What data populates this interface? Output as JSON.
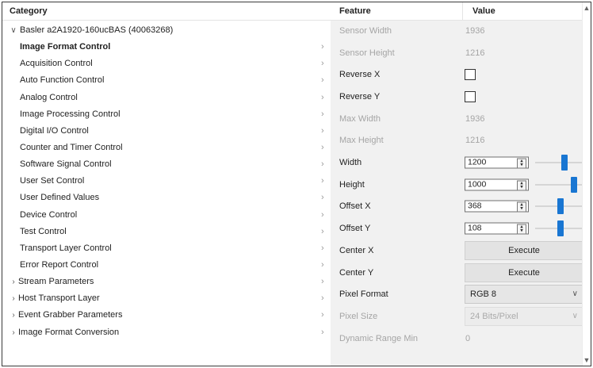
{
  "headers": {
    "category": "Category",
    "feature": "Feature",
    "value": "Value"
  },
  "tree": {
    "root_label": "Basler a2A1920-160ucBAS (40063268)",
    "children": [
      {
        "label": "Image Format Control",
        "selected": true
      },
      {
        "label": "Acquisition Control"
      },
      {
        "label": "Auto Function Control"
      },
      {
        "label": "Analog Control"
      },
      {
        "label": "Image Processing Control"
      },
      {
        "label": "Digital I/O Control"
      },
      {
        "label": "Counter and Timer Control"
      },
      {
        "label": "Software Signal Control"
      },
      {
        "label": "User Set Control"
      },
      {
        "label": "User Defined Values"
      },
      {
        "label": "Device Control"
      },
      {
        "label": "Test Control"
      },
      {
        "label": "Transport Layer Control"
      },
      {
        "label": "Error Report Control"
      }
    ],
    "siblings": [
      {
        "label": "Stream Parameters"
      },
      {
        "label": "Host Transport Layer"
      },
      {
        "label": "Event Grabber Parameters"
      },
      {
        "label": "Image Format Conversion"
      }
    ]
  },
  "features": [
    {
      "name": "Sensor Width",
      "value": "1936",
      "kind": "text",
      "disabled": true
    },
    {
      "name": "Sensor Height",
      "value": "1216",
      "kind": "text",
      "disabled": true
    },
    {
      "name": "Reverse X",
      "kind": "checkbox",
      "checked": false
    },
    {
      "name": "Reverse Y",
      "kind": "checkbox",
      "checked": false
    },
    {
      "name": "Max Width",
      "value": "1936",
      "kind": "text",
      "disabled": true
    },
    {
      "name": "Max Height",
      "value": "1216",
      "kind": "text",
      "disabled": true
    },
    {
      "name": "Width",
      "value": "1200",
      "kind": "spin",
      "slider_fraction": 0.6
    },
    {
      "name": "Height",
      "value": "1000",
      "kind": "spin",
      "slider_fraction": 0.8
    },
    {
      "name": "Offset X",
      "value": "368",
      "kind": "spin",
      "slider_fraction": 0.52
    },
    {
      "name": "Offset Y",
      "value": "108",
      "kind": "spin",
      "slider_fraction": 0.52
    },
    {
      "name": "Center X",
      "button_label": "Execute",
      "kind": "button"
    },
    {
      "name": "Center Y",
      "button_label": "Execute",
      "kind": "button"
    },
    {
      "name": "Pixel Format",
      "value": "RGB 8",
      "kind": "combo"
    },
    {
      "name": "Pixel Size",
      "value": "24 Bits/Pixel",
      "kind": "combo",
      "disabled": true
    },
    {
      "name": "Dynamic Range Min",
      "value": "0",
      "kind": "text",
      "disabled": true
    }
  ],
  "accent_color": "#1976d2"
}
